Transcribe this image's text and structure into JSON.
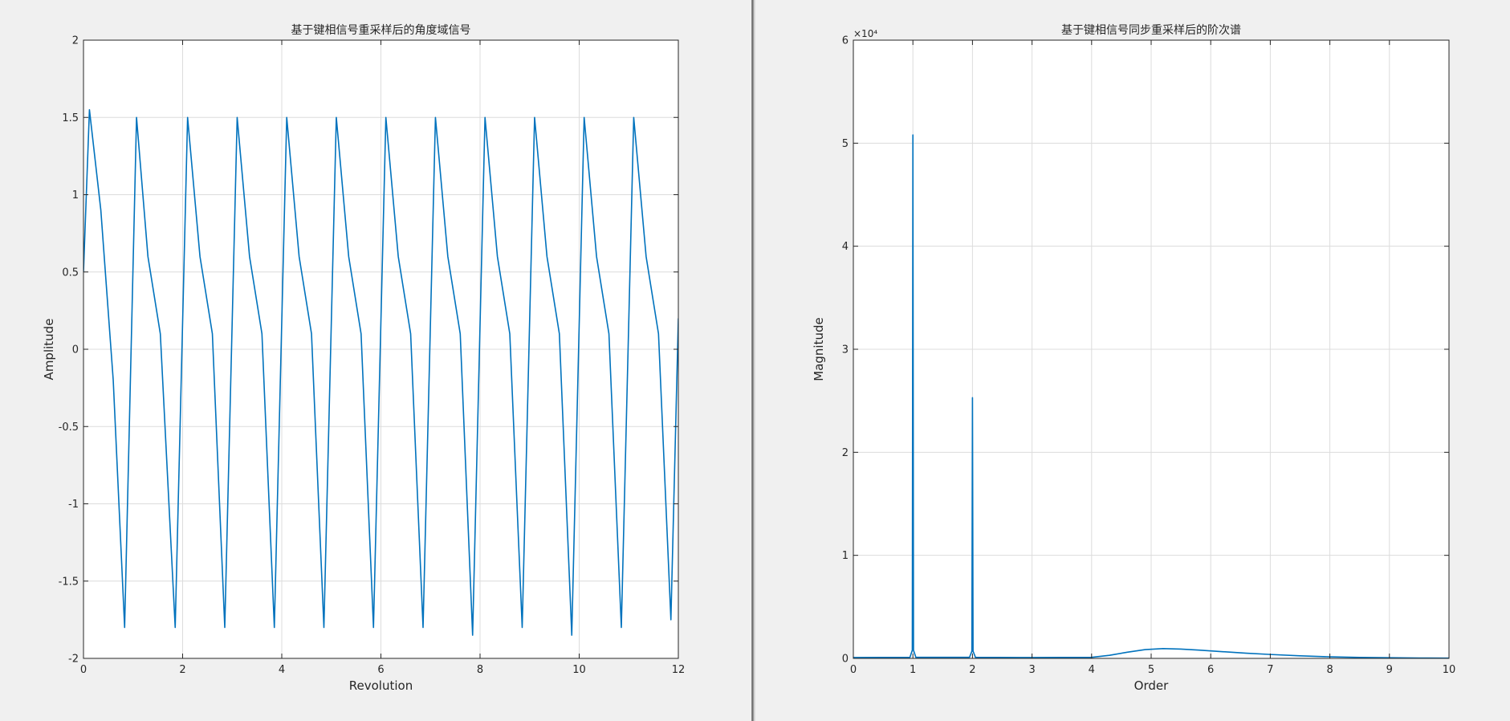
{
  "figure": {
    "background": "#f0f0f0",
    "axes_background": "#ffffff",
    "grid_color": "#dcdcdc",
    "line_color": "#0072bd",
    "text_color": "#262626"
  },
  "chart_data": [
    {
      "type": "line",
      "title": "基于键相信号重采样后的角度域信号",
      "xlabel": "Revolution",
      "ylabel": "Amplitude",
      "xlim": [
        0,
        12
      ],
      "ylim": [
        -2,
        2
      ],
      "xticks": [
        0,
        2,
        4,
        6,
        8,
        10,
        12
      ],
      "xtick_labels": [
        "0",
        "2",
        "4",
        "6",
        "8",
        "10",
        "12"
      ],
      "yticks": [
        -2,
        -1.5,
        -1,
        -0.5,
        0,
        0.5,
        1,
        1.5,
        2
      ],
      "ytick_labels": [
        "-2",
        "-1.5",
        "-1",
        "-0.5",
        "0",
        "0.5",
        "1",
        "1.5",
        "2"
      ],
      "grid": true,
      "series": [
        {
          "x": [
            0,
            0.12,
            0.35,
            0.6,
            0.83,
            1.07,
            1.3,
            1.55,
            1.85,
            2.1,
            2.35,
            2.6,
            2.85,
            3.1,
            3.35,
            3.6,
            3.85,
            4.1,
            4.35,
            4.6,
            4.85,
            5.1,
            5.35,
            5.6,
            5.85,
            6.1,
            6.35,
            6.6,
            6.85,
            7.1,
            7.35,
            7.6,
            7.85,
            8.1,
            8.35,
            8.6,
            8.85,
            9.1,
            9.35,
            9.6,
            9.85,
            10.1,
            10.35,
            10.6,
            10.85,
            11.1,
            11.35,
            11.6,
            11.85,
            12.0
          ],
          "y": [
            0.5,
            1.55,
            0.9,
            -0.2,
            -1.8,
            1.5,
            0.6,
            0.1,
            -1.8,
            1.5,
            0.6,
            0.1,
            -1.8,
            1.5,
            0.6,
            0.1,
            -1.8,
            1.5,
            0.6,
            0.1,
            -1.8,
            1.5,
            0.6,
            0.1,
            -1.8,
            1.5,
            0.6,
            0.1,
            -1.8,
            1.5,
            0.6,
            0.1,
            -1.85,
            1.5,
            0.6,
            0.1,
            -1.8,
            1.5,
            0.6,
            0.1,
            -1.85,
            1.5,
            0.6,
            0.1,
            -1.8,
            1.5,
            0.6,
            0.1,
            -1.75,
            0.2
          ]
        }
      ]
    },
    {
      "type": "line",
      "title": "基于键相信号同步重采样后的阶次谱",
      "xlabel": "Order",
      "ylabel": "Magnitude",
      "y_exponent_label": "×10⁴",
      "xlim": [
        0,
        10
      ],
      "ylim": [
        0,
        60000
      ],
      "xticks": [
        0,
        1,
        2,
        3,
        4,
        5,
        6,
        7,
        8,
        9,
        10
      ],
      "xtick_labels": [
        "0",
        "1",
        "2",
        "3",
        "4",
        "5",
        "6",
        "7",
        "8",
        "9",
        "10"
      ],
      "yticks": [
        0,
        10000,
        20000,
        30000,
        40000,
        50000,
        60000
      ],
      "ytick_labels": [
        "0",
        "1",
        "2",
        "3",
        "4",
        "5",
        "6"
      ],
      "grid": true,
      "series": [
        {
          "x": [
            0,
            0.95,
            0.99,
            1.0,
            1.01,
            1.05,
            1.95,
            1.99,
            2.0,
            2.01,
            2.05,
            3.0,
            4.0,
            4.3,
            4.6,
            4.9,
            5.2,
            5.5,
            5.8,
            6.2,
            6.6,
            7.0,
            7.5,
            8.0,
            8.5,
            9.0,
            9.5,
            10.0
          ],
          "y": [
            80,
            100,
            800,
            50800,
            800,
            100,
            100,
            700,
            25300,
            700,
            100,
            80,
            100,
            300,
            600,
            850,
            950,
            900,
            800,
            650,
            500,
            380,
            250,
            150,
            90,
            60,
            40,
            30
          ]
        }
      ]
    }
  ]
}
